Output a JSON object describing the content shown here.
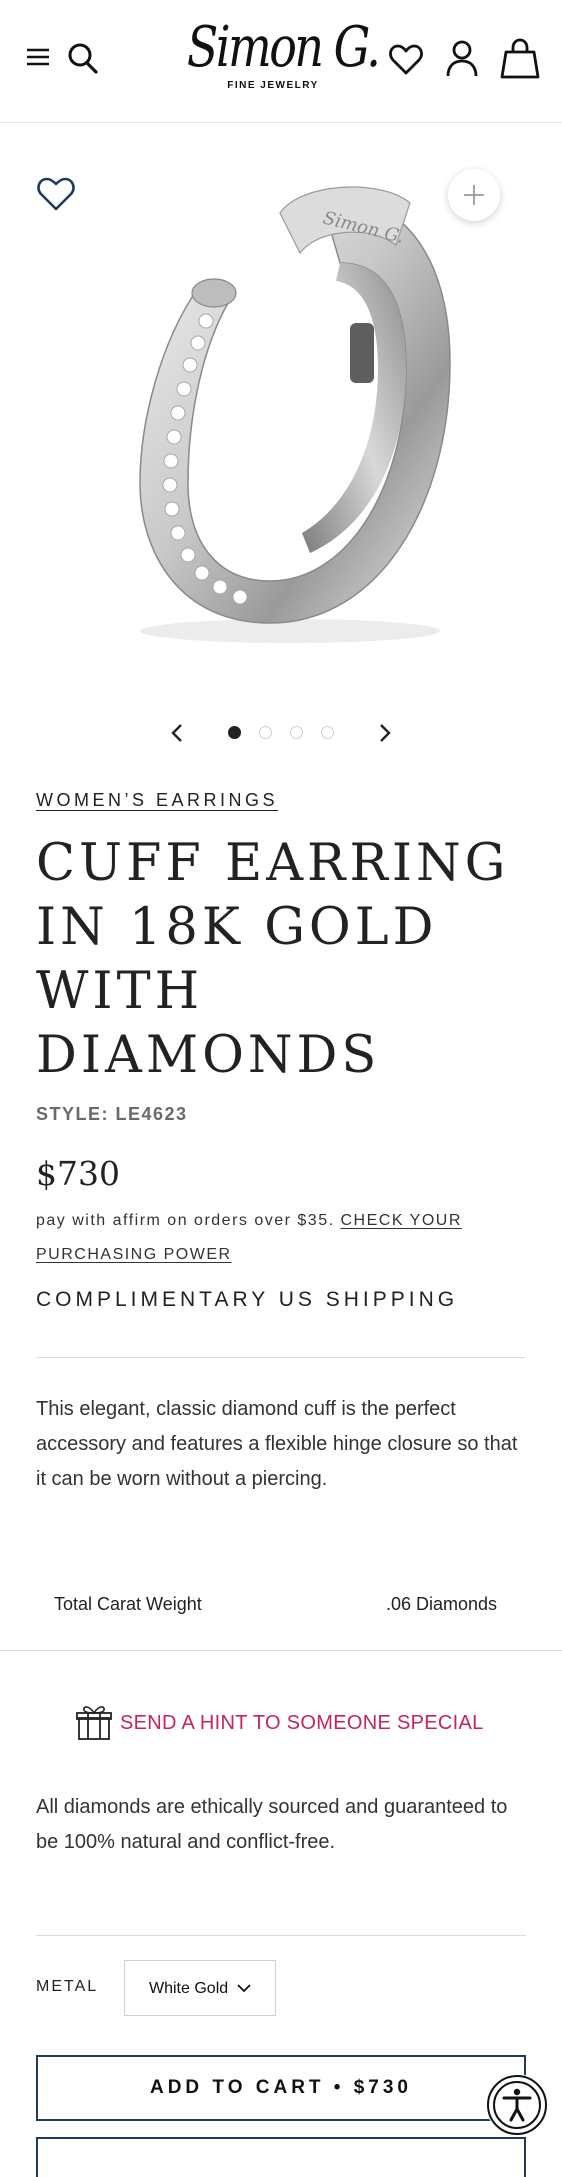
{
  "header": {
    "logo_main": "Simon G.",
    "logo_sub": "FINE JEWELRY",
    "icons": [
      "menu-icon",
      "search-icon",
      "heart-icon",
      "account-icon",
      "bag-icon"
    ]
  },
  "gallery": {
    "image_engraving": "Simon G.",
    "slide_count": 4,
    "active_slide": 1
  },
  "product": {
    "category": "WOMEN’S EARRINGS",
    "title_lines": [
      "CUFF EARRING",
      "IN 18K GOLD",
      "WITH",
      "DIAMONDS"
    ],
    "style": "STYLE: LE4623",
    "price": "$730",
    "affirm_text": "pay with affirm on orders over $35.",
    "affirm_link": "CHECK YOUR PURCHASING POWER",
    "shipping": "COMPLIMENTARY US SHIPPING",
    "description": "This elegant, classic diamond cuff is the perfect accessory and features a flexible hinge closure so that it can be worn without a piercing.",
    "spec_label": "Total Carat Weight",
    "spec_value": ".06 Diamonds",
    "hint": "SEND A HINT TO SOMEONE SPECIAL",
    "ethics": "All diamonds are ethically sourced and guaranteed to be 100% natural and conflict-free.",
    "metal_label": "METAL",
    "metal_value": "White Gold",
    "add_to_cart": "ADD TO CART  •  $730"
  },
  "colors": {
    "accent_pink": "#c8235a",
    "button_border": "#1f3a5f",
    "text": "#222222"
  }
}
